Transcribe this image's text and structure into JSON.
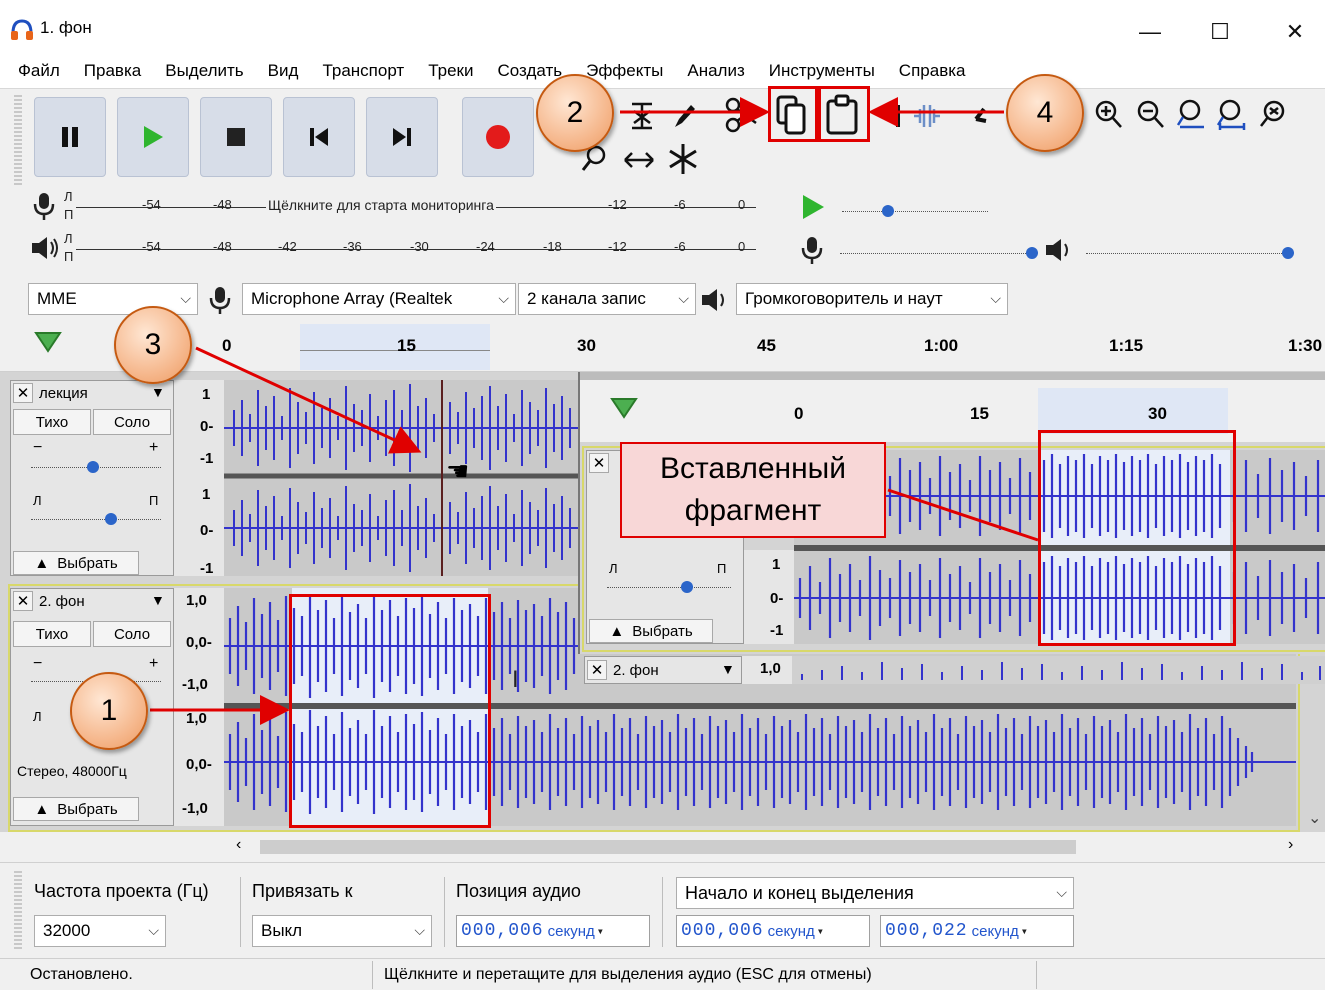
{
  "window": {
    "title": "1. фон",
    "minimize": "—",
    "maximize": "☐",
    "close": "✕"
  },
  "menu": [
    "Файл",
    "Правка",
    "Выделить",
    "Вид",
    "Транспорт",
    "Треки",
    "Создать",
    "Эффекты",
    "Анализ",
    "Инструменты",
    "Справка"
  ],
  "meters": {
    "record_channels": [
      "Л",
      "П"
    ],
    "record_ticks": [
      "-54",
      "-48",
      "-12",
      "-6",
      "0"
    ],
    "record_hint": "Щёлкните для старта мониторинга",
    "play_channels": [
      "Л",
      "П"
    ],
    "play_ticks": [
      "-54",
      "-48",
      "-42",
      "-36",
      "-30",
      "-24",
      "-18",
      "-12",
      "-6",
      "0"
    ]
  },
  "devices": {
    "host": "MME",
    "input": "Microphone Array (Realtek",
    "channels": "2 канала запис",
    "output": "Громкоговоритель и наут"
  },
  "ruler": {
    "ticks": [
      "0",
      "15",
      "30",
      "45",
      "1:00",
      "1:15",
      "1:30"
    ]
  },
  "tracks": [
    {
      "name": "лекция",
      "mute": "Тихо",
      "solo": "Соло",
      "gain_min": "−",
      "gain_max": "+",
      "pan_left": "Л",
      "pan_right": "П",
      "select": "Выбрать",
      "scale": [
        "1",
        "0-",
        "-1",
        "1",
        "0-",
        "-1"
      ]
    },
    {
      "name": "2. фон",
      "mute": "Тихо",
      "solo": "Соло",
      "gain_min": "−",
      "gain_max": "+",
      "pan_left": "Л",
      "info": "Стерео, 48000Гц",
      "select": "Выбрать",
      "scale": [
        "1,0",
        "0,0-",
        "-1,0",
        "1,0",
        "0,0-",
        "-1,0"
      ]
    }
  ],
  "inset": {
    "ruler_ticks": [
      "0",
      "15",
      "30"
    ],
    "label": "Вставленный фрагмент",
    "pan_left": "Л",
    "pan_right": "П",
    "select": "Выбрать",
    "scale": [
      "1",
      "0-",
      "-1"
    ],
    "track2_name": "2. фон",
    "track2_scale": "1,0"
  },
  "callouts": [
    "1",
    "2",
    "3",
    "4"
  ],
  "bottom": {
    "rate_label": "Частота проекта (Гц)",
    "rate_value": "32000",
    "snap_label": "Привязать к",
    "snap_value": "Выкл",
    "pos_label": "Позиция аудио",
    "pos_value": "000,006",
    "pos_unit": "секунд",
    "sel_label": "Начало и конец выделения",
    "sel_start": "000,006",
    "sel_start_unit": "секунд",
    "sel_end": "000,022",
    "sel_end_unit": "секунд"
  },
  "status": {
    "left": "Остановлено.",
    "right": "Щёлкните и перетащите для выделения аудио (ESC для отмены)"
  },
  "colors": {
    "wave": "#3333cc",
    "callout": "#f4b183",
    "highlight": "#e00000",
    "toolbar_button": "#d7dde8"
  }
}
